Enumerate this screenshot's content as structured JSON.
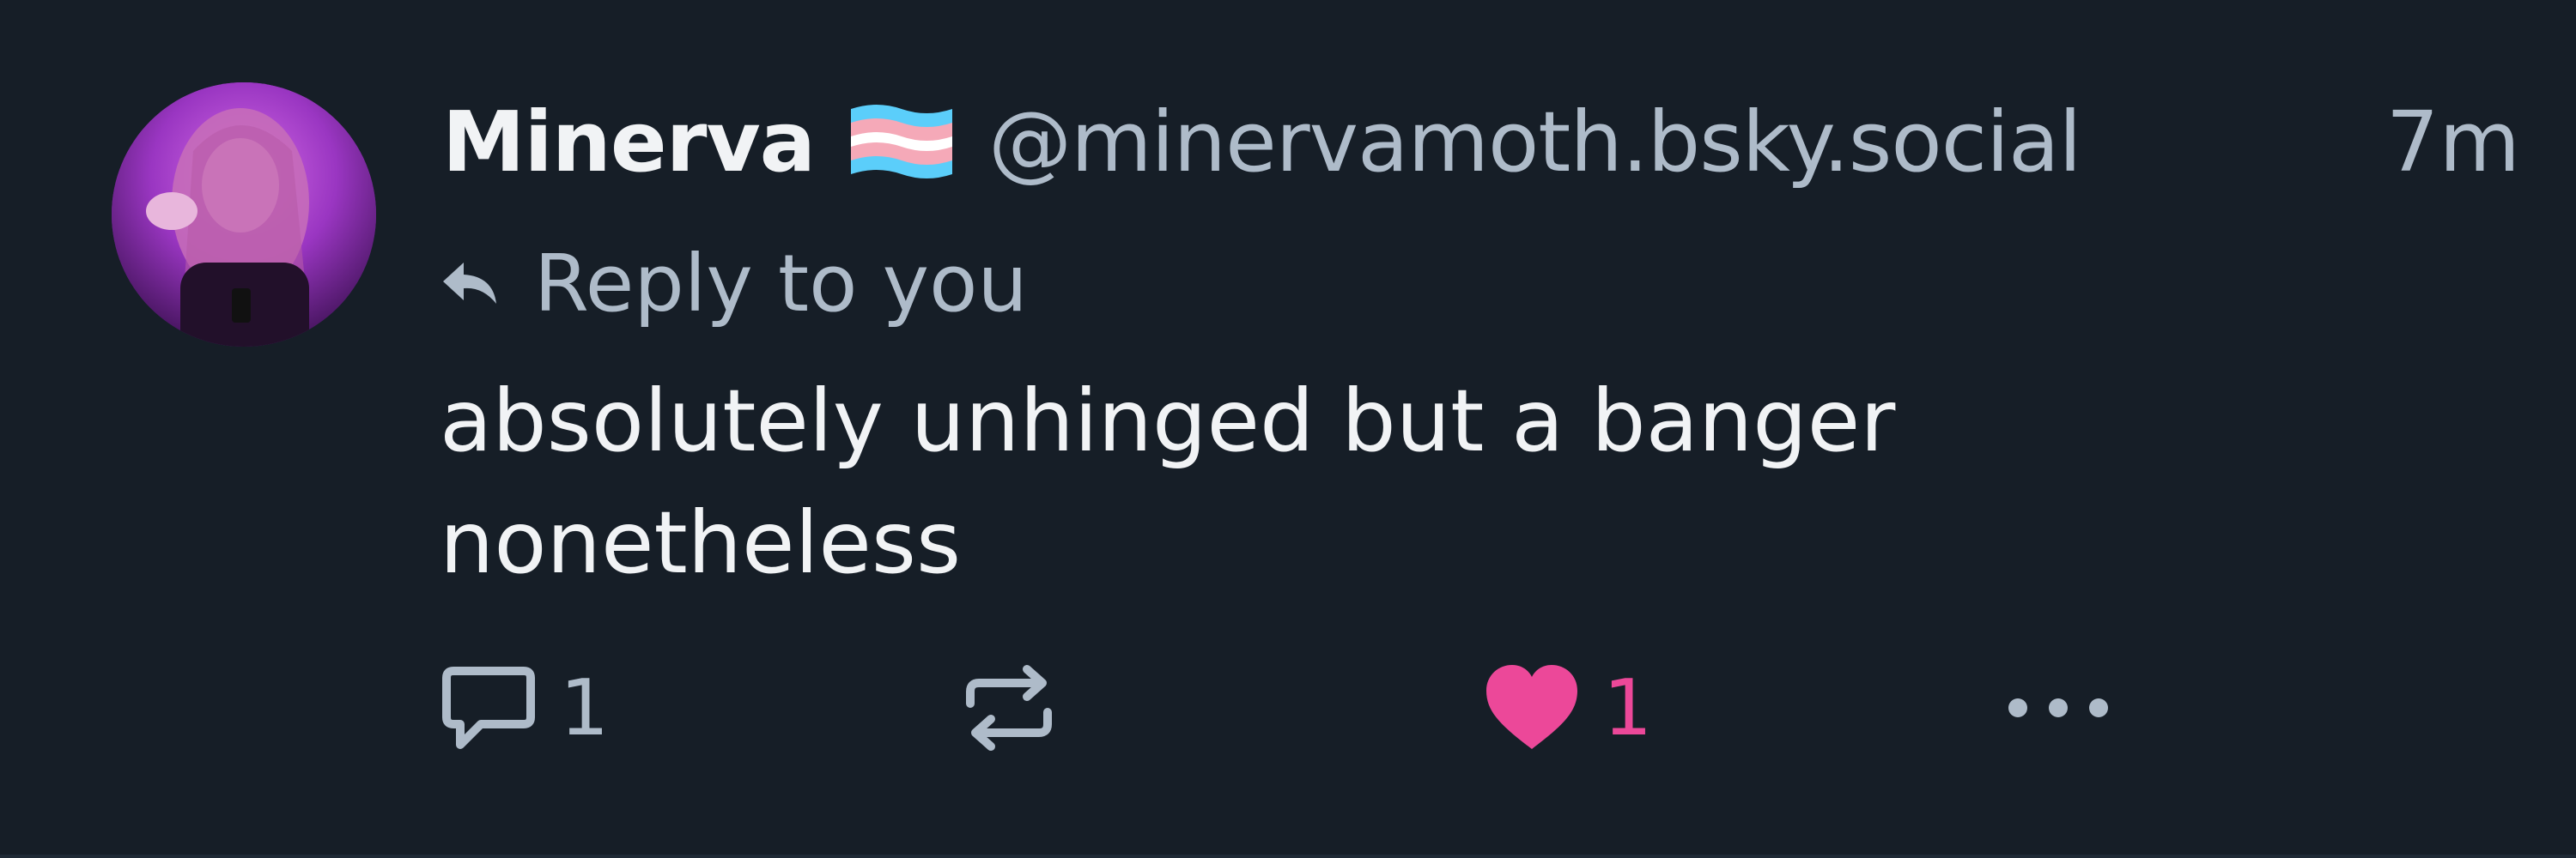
{
  "post": {
    "author": {
      "display_name": "Minerva",
      "handle": "@minervamoth.bsky.social",
      "flag_icon": "transgender-flag-icon"
    },
    "timestamp": "7m",
    "reply_context": "Reply to you",
    "text": "absolutely unhinged but a banger nonetheless",
    "actions": {
      "reply_count": "1",
      "like_count": "1",
      "liked": true
    }
  },
  "colors": {
    "background": "#161e27",
    "primary_text": "#f1f3f5",
    "secondary_text": "#aebbc9",
    "like_pink": "#ec4899",
    "flag_blue": "#5bcefa",
    "flag_pink": "#f5a9b8",
    "flag_white": "#ffffff"
  }
}
